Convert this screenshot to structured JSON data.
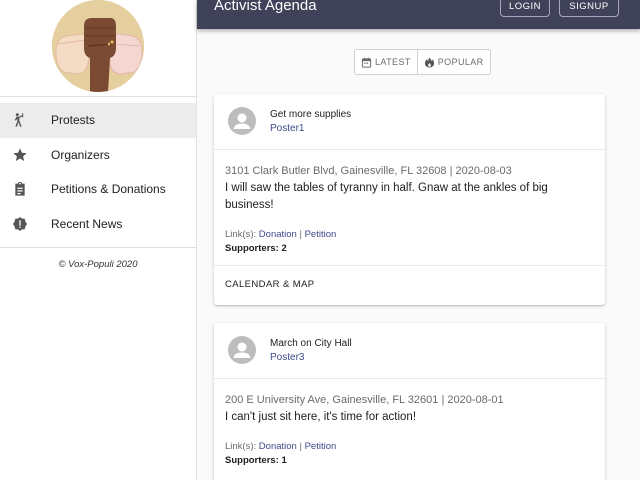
{
  "header": {
    "title": "Activist Agenda",
    "login_label": "LOGIN",
    "signup_label": "SIGNUP"
  },
  "sidebar": {
    "logo_icon": "raised-fists-logo",
    "items": [
      {
        "label": "Protests",
        "icon": "protest-icon",
        "active": true
      },
      {
        "label": "Organizers",
        "icon": "star-icon",
        "active": false
      },
      {
        "label": "Petitions & Donations",
        "icon": "clipboard-icon",
        "active": false
      },
      {
        "label": "Recent News",
        "icon": "alert-badge-icon",
        "active": false
      }
    ],
    "copyright": "© Vox-Populi 2020"
  },
  "sort_toggle": {
    "latest_label": "LATEST",
    "popular_label": "POPULAR"
  },
  "posts": [
    {
      "title": "Get more supplies",
      "poster": "Poster1",
      "meta": "3101 Clark Butler Blvd, Gainesville, FL 32608 | 2020-08-03",
      "description": "I will saw the tables of tyranny in half. Gnaw at the ankles of big business!",
      "links_label": "Link(s):",
      "donation_label": "Donation",
      "separator": "|",
      "petition_label": "Petition",
      "supporters": "Supporters: 2",
      "action_label": "CALENDAR & MAP"
    },
    {
      "title": "March on City Hall",
      "poster": "Poster3",
      "meta": "200 E University Ave, Gainesville, FL 32601 | 2020-08-01",
      "description": "I can't just sit here, it's time for action!",
      "links_label": "Link(s):",
      "donation_label": "Donation",
      "separator": "|",
      "petition_label": "Petition",
      "supporters": "Supporters: 1"
    }
  ],
  "colors": {
    "header_bg": "#3f4259",
    "link": "#3f4a8a",
    "active_nav_bg": "#ececec"
  }
}
